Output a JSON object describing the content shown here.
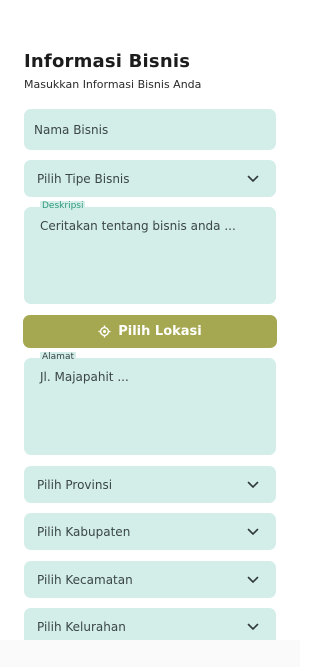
{
  "header": {
    "title": "Informasi Bisnis",
    "subtitle": "Masukkan Informasi Bisnis Anda"
  },
  "form": {
    "nama_bisnis": {
      "placeholder": "Nama Bisnis"
    },
    "tipe_bisnis": {
      "placeholder": "Pilih Tipe Bisnis",
      "icon": "chevron-down-icon"
    },
    "deskripsi": {
      "label": "Deskripsi",
      "placeholder": "Ceritakan tentang bisnis anda ..."
    },
    "lokasi_button": {
      "label": "Pilih Lokasi",
      "icon": "location-target-icon"
    },
    "alamat": {
      "label": "Alamat",
      "placeholder": "Jl. Majapahit ..."
    },
    "provinsi": {
      "placeholder": "Pilih Provinsi",
      "icon": "chevron-down-icon"
    },
    "kabupaten": {
      "placeholder": "Pilih Kabupaten",
      "icon": "chevron-down-icon"
    },
    "kecamatan": {
      "placeholder": "Pilih Kecamatan",
      "icon": "chevron-down-icon"
    },
    "kelurahan": {
      "placeholder": "Pilih Kelurahan",
      "icon": "chevron-down-icon"
    }
  },
  "colors": {
    "field_bg": "#d3ede8",
    "button_bg": "#a5a851",
    "label_accent": "#2f9a7e"
  }
}
